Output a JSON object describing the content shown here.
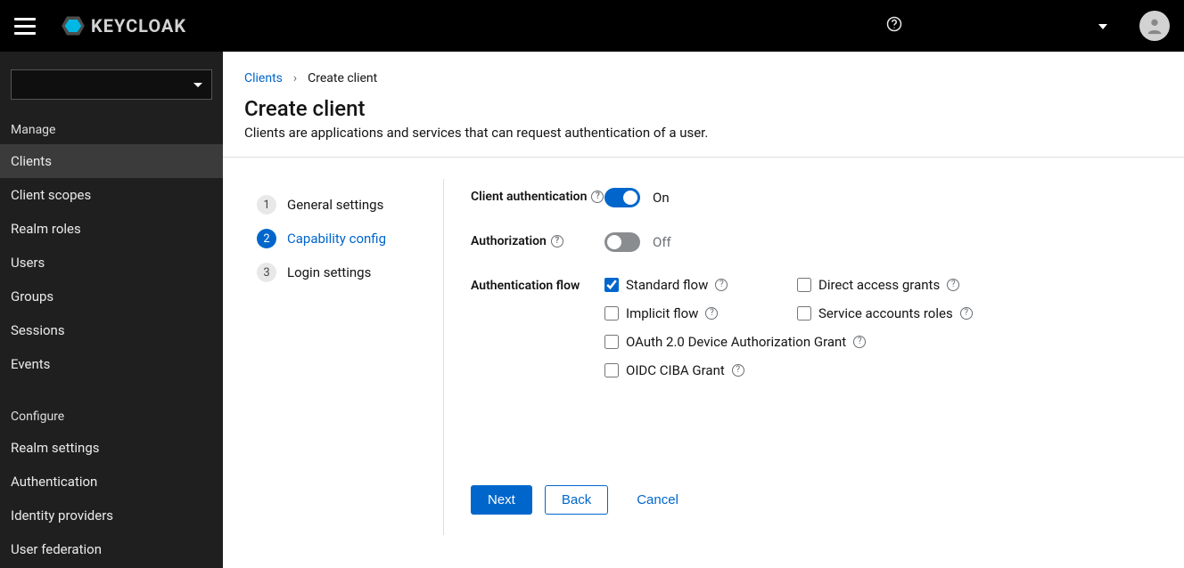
{
  "brand": "KEYCLOAK",
  "topbar": {
    "help_aria": "Help",
    "user_menu_aria": "User menu",
    "account_aria": "Account"
  },
  "sidebar": {
    "realm_selector_value": "",
    "sections": {
      "manage": {
        "label": "Manage",
        "items": [
          {
            "label": "Clients",
            "active": true
          },
          {
            "label": "Client scopes",
            "active": false
          },
          {
            "label": "Realm roles",
            "active": false
          },
          {
            "label": "Users",
            "active": false
          },
          {
            "label": "Groups",
            "active": false
          },
          {
            "label": "Sessions",
            "active": false
          },
          {
            "label": "Events",
            "active": false
          }
        ]
      },
      "configure": {
        "label": "Configure",
        "items": [
          {
            "label": "Realm settings"
          },
          {
            "label": "Authentication"
          },
          {
            "label": "Identity providers"
          },
          {
            "label": "User federation"
          }
        ]
      }
    }
  },
  "breadcrumb": {
    "root": "Clients",
    "current": "Create client"
  },
  "page": {
    "title": "Create client",
    "description": "Clients are applications and services that can request authentication of a user."
  },
  "wizard": {
    "steps": [
      {
        "number": "1",
        "label": "General settings"
      },
      {
        "number": "2",
        "label": "Capability config"
      },
      {
        "number": "3",
        "label": "Login settings"
      }
    ],
    "active_step": 2
  },
  "form": {
    "client_authentication": {
      "label": "Client authentication",
      "value": true,
      "value_text": "On"
    },
    "authorization": {
      "label": "Authorization",
      "value": false,
      "value_text": "Off"
    },
    "authentication_flow": {
      "label": "Authentication flow",
      "options": {
        "standard_flow": {
          "label": "Standard flow",
          "checked": true
        },
        "direct_access_grants": {
          "label": "Direct access grants",
          "checked": false
        },
        "implicit_flow": {
          "label": "Implicit flow",
          "checked": false
        },
        "service_accounts_roles": {
          "label": "Service accounts roles",
          "checked": false
        },
        "oauth2_device_grant": {
          "label": "OAuth 2.0 Device Authorization Grant",
          "checked": false
        },
        "oidc_ciba_grant": {
          "label": "OIDC CIBA Grant",
          "checked": false
        }
      }
    }
  },
  "buttons": {
    "next": "Next",
    "back": "Back",
    "cancel": "Cancel"
  }
}
